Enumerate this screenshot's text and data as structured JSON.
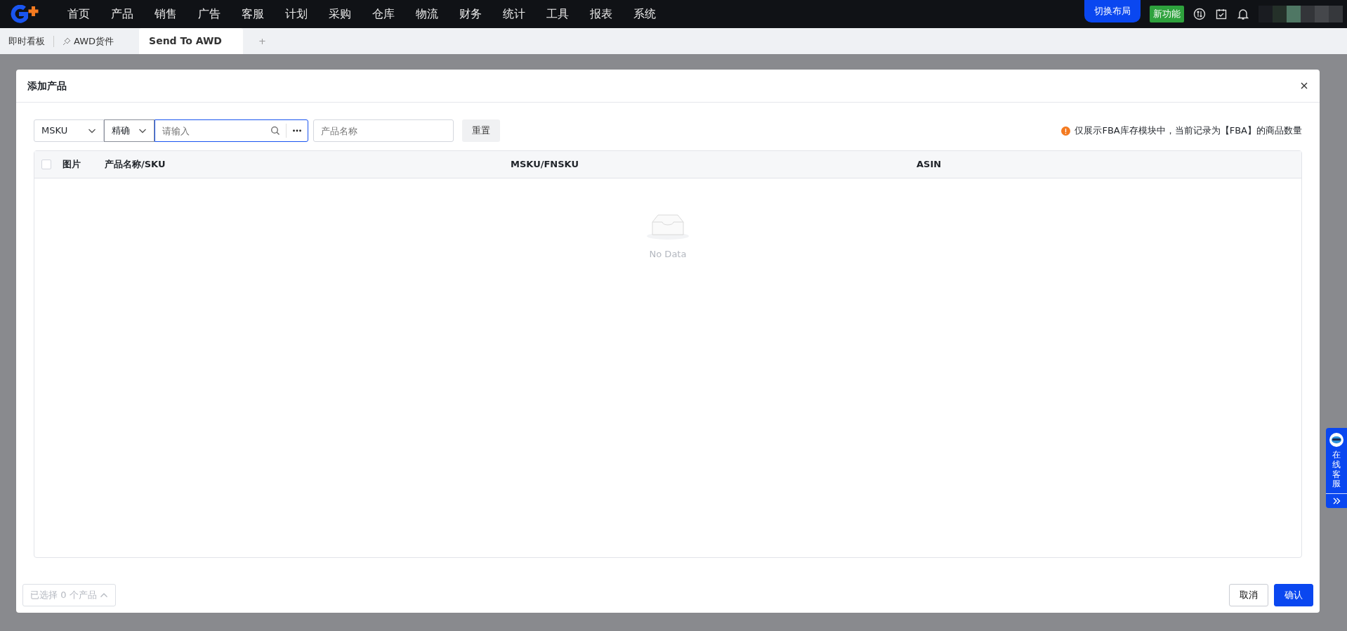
{
  "top_nav": {
    "items": [
      "首页",
      "产品",
      "销售",
      "广告",
      "客服",
      "计划",
      "采购",
      "仓库",
      "物流",
      "财务",
      "统计",
      "工具",
      "报表",
      "系统"
    ],
    "layout_button": "切换布局",
    "new_feature_badge": "新功能"
  },
  "tabs": [
    {
      "label": "即时看板",
      "selected": false,
      "pinned": false
    },
    {
      "label": "AWD货件",
      "selected": false,
      "pinned": true
    },
    {
      "label": "Send To AWD",
      "selected": true,
      "pinned": false
    }
  ],
  "add_tab": "+",
  "dialog": {
    "title": "添加产品",
    "filters": {
      "field_select": "MSKU",
      "match_select": "精确",
      "search": {
        "placeholder": "请输入"
      },
      "name_field": {
        "placeholder": "产品名称"
      },
      "reset_button": "重置"
    },
    "notice": "仅展示FBA库存模块中，当前记录为【FBA】的商品数量",
    "table": {
      "columns": [
        "图片",
        "产品名称/SKU",
        "MSKU/FNSKU",
        "ASIN"
      ],
      "select_all_checked": false,
      "empty_text": "No Data"
    },
    "selection_summary": "已选择 0 个产品",
    "buttons": [
      {
        "label": "取消",
        "kind": "default"
      },
      {
        "label": "确认",
        "kind": "primary"
      }
    ]
  },
  "support_widget": {
    "label": "在线客服"
  }
}
